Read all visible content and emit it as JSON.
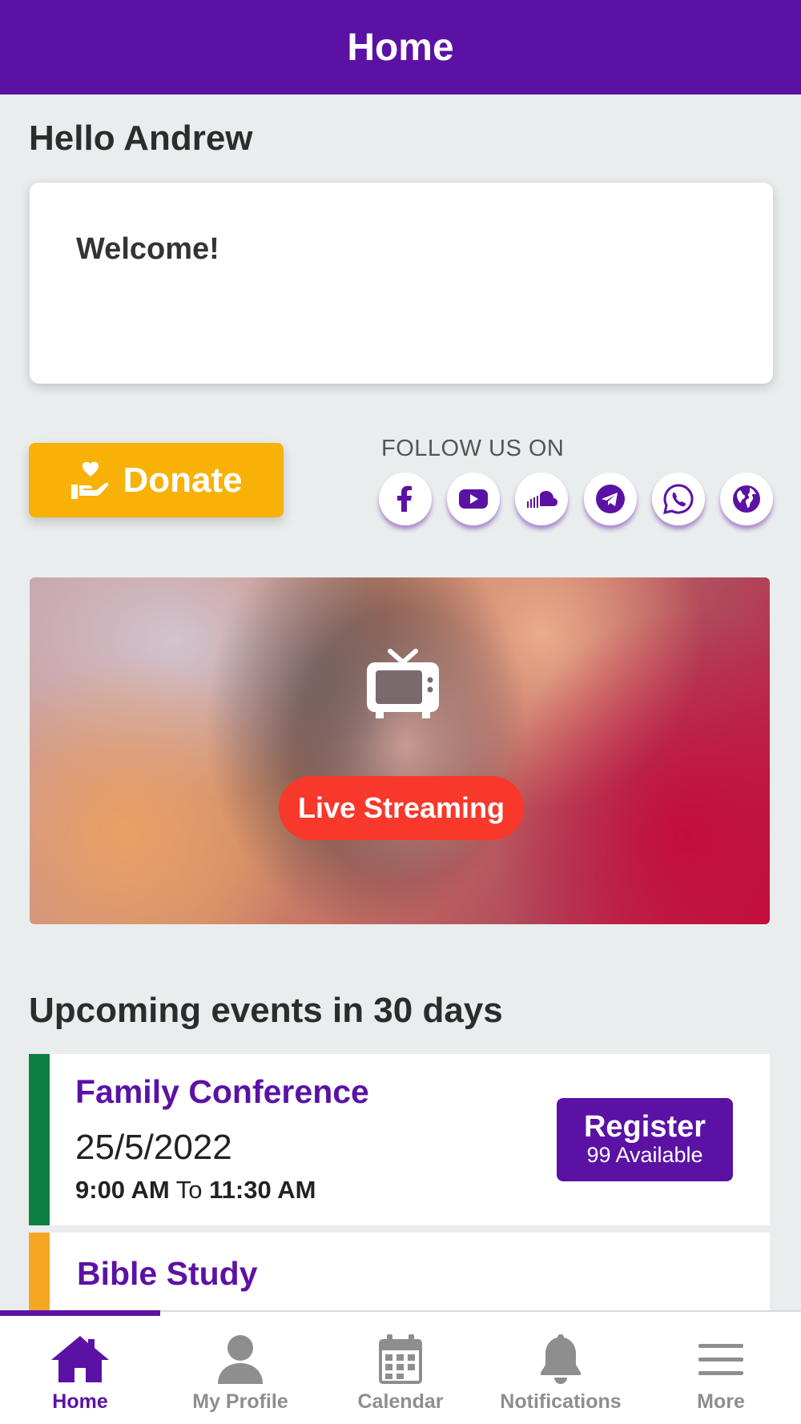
{
  "header": {
    "title": "Home"
  },
  "greeting": "Hello Andrew",
  "welcome_card": {
    "text": "Welcome!"
  },
  "donate": {
    "label": "Donate",
    "icon": "hand-heart-icon"
  },
  "follow": {
    "label": "FOLLOW US ON",
    "links": [
      {
        "name": "facebook",
        "icon": "facebook-icon"
      },
      {
        "name": "youtube",
        "icon": "youtube-icon"
      },
      {
        "name": "soundcloud",
        "icon": "soundcloud-icon"
      },
      {
        "name": "telegram",
        "icon": "telegram-icon"
      },
      {
        "name": "whatsapp",
        "icon": "whatsapp-icon"
      },
      {
        "name": "website",
        "icon": "globe-icon"
      }
    ]
  },
  "live_stream": {
    "label": "Live Streaming",
    "icon": "tv-icon"
  },
  "events": {
    "heading": "Upcoming events in 30 days",
    "items": [
      {
        "title": "Family Conference",
        "date": "25/5/2022",
        "start": "9:00 AM",
        "to": "To",
        "end": "11:30 AM",
        "register_label": "Register",
        "available": "99 Available",
        "stripe_color": "#0c8043"
      },
      {
        "title": "Bible Study",
        "stripe_color": "#f5a623"
      }
    ]
  },
  "tabs": [
    {
      "label": "Home",
      "icon": "home-icon",
      "active": true
    },
    {
      "label": "My Profile",
      "icon": "user-icon",
      "active": false
    },
    {
      "label": "Calendar",
      "icon": "calendar-icon",
      "active": false
    },
    {
      "label": "Notifications",
      "icon": "bell-icon",
      "active": false
    },
    {
      "label": "More",
      "icon": "menu-icon",
      "active": false
    }
  ],
  "colors": {
    "brand": "#5b12a4",
    "donate": "#f8b106",
    "live": "#f8382a",
    "background": "#eaedee",
    "inactive_tab": "#8e8e8e"
  }
}
